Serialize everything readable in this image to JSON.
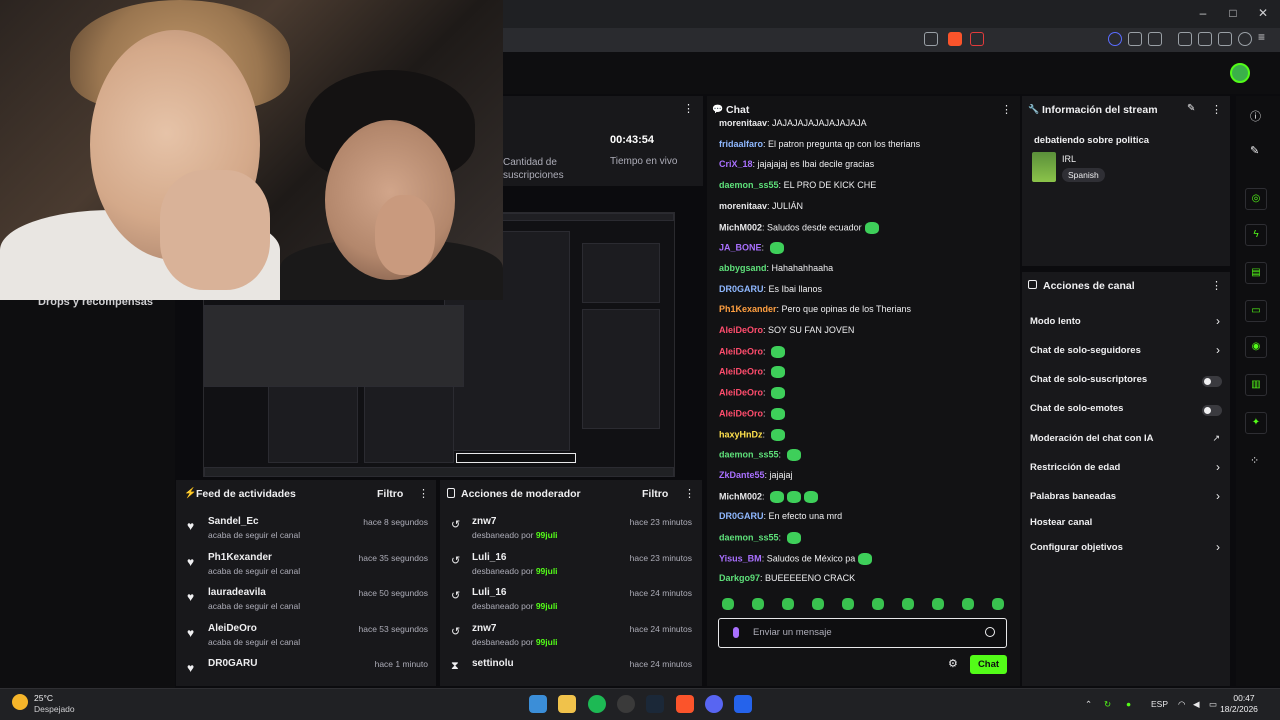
{
  "chat": {
    "title": "Chat",
    "messages": [
      {
        "user": "morenitaav",
        "color": "#e8e8ea",
        "text": "JAJAJAJAJAJAJAJAJA",
        "emotes": 0
      },
      {
        "user": "fridaalfaro",
        "color": "#8fb8ff",
        "text": "El patron pregunta qp con los therians",
        "emotes": 0
      },
      {
        "user": "CriX_18",
        "color": "#a970ff",
        "text": "jajajajaj es Ibai decile gracias",
        "emotes": 0
      },
      {
        "user": "daemon_ss55",
        "color": "#5ee07a",
        "text": "EL PRO DE KICK CHE",
        "emotes": 0
      },
      {
        "user": "morenitaav",
        "color": "#e8e8ea",
        "text": "JULIÁN",
        "emotes": 0
      },
      {
        "user": "MichM002",
        "color": "#e8e8ea",
        "text": "Saludos desde ecuador",
        "emotes": 1
      },
      {
        "user": "JA_BONE",
        "color": "#a970ff",
        "text": "",
        "emotes": 1
      },
      {
        "user": "abbygsand",
        "color": "#5ee07a",
        "text": "Hahahahhaaha",
        "emotes": 0
      },
      {
        "user": "DR0GARU",
        "color": "#8fb8ff",
        "text": "Es Ibai llanos",
        "emotes": 0
      },
      {
        "user": "Ph1Kexander",
        "color": "#ff9f40",
        "text": "Pero que opinas de los Therians",
        "emotes": 0
      },
      {
        "user": "AleiDeOro",
        "color": "#ff4d6d",
        "text": "SOY SU FAN JOVEN",
        "emotes": 0
      },
      {
        "user": "AleiDeOro",
        "color": "#ff4d6d",
        "text": "",
        "emotes": 1
      },
      {
        "user": "AleiDeOro",
        "color": "#ff4d6d",
        "text": "",
        "emotes": 1
      },
      {
        "user": "AleiDeOro",
        "color": "#ff4d6d",
        "text": "",
        "emotes": 1
      },
      {
        "user": "AleiDeOro",
        "color": "#ff4d6d",
        "text": "",
        "emotes": 1
      },
      {
        "user": "haxyHnDz",
        "color": "#ffe14d",
        "text": "",
        "emotes": 1
      },
      {
        "user": "daemon_ss55",
        "color": "#5ee07a",
        "text": "",
        "emotes": 1
      },
      {
        "user": "ZkDante55",
        "color": "#a970ff",
        "text": "jajajaj",
        "emotes": 0
      },
      {
        "user": "MichM002",
        "color": "#e8e8ea",
        "text": "",
        "emotes": 3
      },
      {
        "user": "DR0GARU",
        "color": "#8fb8ff",
        "text": "En efecto una mrd",
        "emotes": 0
      },
      {
        "user": "daemon_ss55",
        "color": "#5ee07a",
        "text": "",
        "emotes": 1
      },
      {
        "user": "Yisus_BM",
        "color": "#a970ff",
        "text": "Saludos de México pa",
        "emotes": 1
      },
      {
        "user": "Darkgo97",
        "color": "#5ee07a",
        "text": "BUEEEEENO CRACK",
        "emotes": 0
      }
    ],
    "input_placeholder": "Enviar un mensaje",
    "send_label": "Chat"
  },
  "stream_info": {
    "title": "Información del stream",
    "stream_title": "debatiendo sobre politica",
    "category": "IRL",
    "language": "Spanish"
  },
  "channel_actions": {
    "title": "Acciones de canal",
    "items": [
      {
        "label": "Modo lento",
        "control": "chevron"
      },
      {
        "label": "Chat de solo-seguidores",
        "control": "chevron"
      },
      {
        "label": "Chat de solo-suscriptores",
        "control": "toggle"
      },
      {
        "label": "Chat de solo-emotes",
        "control": "toggle"
      },
      {
        "label": "Moderación del chat con IA",
        "control": "external"
      },
      {
        "label": "Restricción de edad",
        "control": "chevron"
      },
      {
        "label": "Palabras baneadas",
        "control": "chevron"
      },
      {
        "label": "Hostear canal",
        "control": "none"
      },
      {
        "label": "Configurar objetivos",
        "control": "chevron"
      }
    ]
  },
  "stats": {
    "uptime": "00:43:54",
    "uptime_label": "Tiempo en vivo",
    "subs_label": "Cantidad de suscripciones"
  },
  "left": {
    "drops_label": "Drops y recompensas"
  },
  "activity_feed": {
    "title": "Feed de actividades",
    "filter": "Filtro",
    "items": [
      {
        "name": "Sandel_Ec",
        "sub": "acaba de seguir el canal",
        "time": "hace 8 segundos"
      },
      {
        "name": "Ph1Kexander",
        "sub": "acaba de seguir el canal",
        "time": "hace 35 segundos"
      },
      {
        "name": "lauradeavila",
        "sub": "acaba de seguir el canal",
        "time": "hace 50 segundos"
      },
      {
        "name": "AleiDeOro",
        "sub": "acaba de seguir el canal",
        "time": "hace 53 segundos"
      },
      {
        "name": "DR0GARU",
        "sub": "",
        "time": "hace 1 minuto"
      }
    ]
  },
  "mod_actions": {
    "title": "Acciones de moderador",
    "filter": "Filtro",
    "items": [
      {
        "name": "znw7",
        "prefix": "desbaneado por ",
        "by": "99juli",
        "time": "hace 23 minutos"
      },
      {
        "name": "Luli_16",
        "prefix": "desbaneado por ",
        "by": "99juli",
        "time": "hace 23 minutos"
      },
      {
        "name": "Luli_16",
        "prefix": "desbaneado por ",
        "by": "99juli",
        "time": "hace 24 minutos"
      },
      {
        "name": "znw7",
        "prefix": "desbaneado por ",
        "by": "99juli",
        "time": "hace 24 minutos"
      },
      {
        "name": "settinolu",
        "prefix": "",
        "by": "",
        "time": "hace 24 minutos"
      }
    ]
  },
  "taskbar": {
    "weather_temp": "25°C",
    "weather_desc": "Despejado",
    "lang": "ESP",
    "time": "00:47",
    "date": "18/2/2026"
  },
  "colors": {
    "accent": "#53fc18",
    "panel": "#18181b",
    "background": "#0e0e10"
  }
}
